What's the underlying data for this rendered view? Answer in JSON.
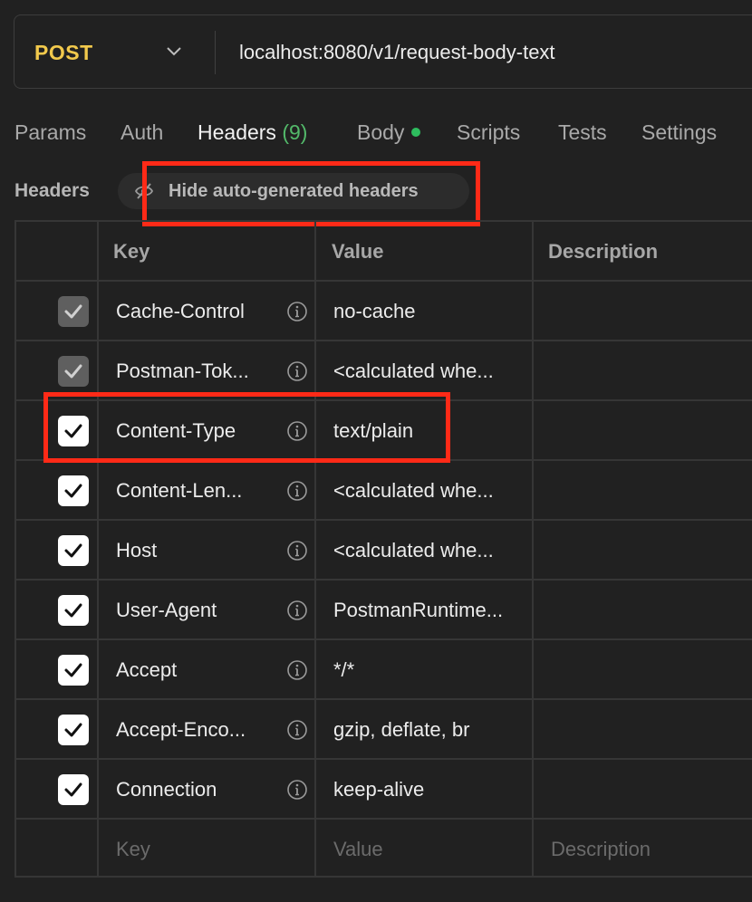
{
  "request": {
    "method": "POST",
    "url": "localhost:8080/v1/request-body-text"
  },
  "tabs": [
    {
      "label": "Params"
    },
    {
      "label": "Auth"
    },
    {
      "label": "Headers",
      "count": "(9)"
    },
    {
      "label": "Body"
    },
    {
      "label": "Scripts"
    },
    {
      "label": "Tests"
    },
    {
      "label": "Settings"
    }
  ],
  "headers_section": {
    "label": "Headers",
    "toggle_label": "Hide auto-generated headers",
    "toggle_icon": "eye-off-icon"
  },
  "table": {
    "columns": [
      "Key",
      "Value",
      "Description"
    ],
    "rows": [
      {
        "key": "Cache-Control",
        "value": "no-cache",
        "checked": true,
        "auto": true
      },
      {
        "key": "Postman-Tok...",
        "value": "<calculated whe...",
        "checked": true,
        "auto": true
      },
      {
        "key": "Content-Type",
        "value": "text/plain",
        "checked": true,
        "auto": false
      },
      {
        "key": "Content-Len...",
        "value": "<calculated whe...",
        "checked": true,
        "auto": false
      },
      {
        "key": "Host",
        "value": "<calculated whe...",
        "checked": true,
        "auto": false
      },
      {
        "key": "User-Agent",
        "value": "PostmanRuntime...",
        "checked": true,
        "auto": false
      },
      {
        "key": "Accept",
        "value": "*/*",
        "checked": true,
        "auto": false
      },
      {
        "key": "Accept-Enco...",
        "value": "gzip, deflate, br",
        "checked": true,
        "auto": false
      },
      {
        "key": "Connection",
        "value": "keep-alive",
        "checked": true,
        "auto": false
      }
    ],
    "new_row": {
      "key_placeholder": "Key",
      "value_placeholder": "Value",
      "description_placeholder": "Description"
    }
  },
  "colors": {
    "method": "#f2c94c",
    "count": "#53b96a",
    "body_dot": "#2ebd5e",
    "highlight": "#ff2a17"
  }
}
